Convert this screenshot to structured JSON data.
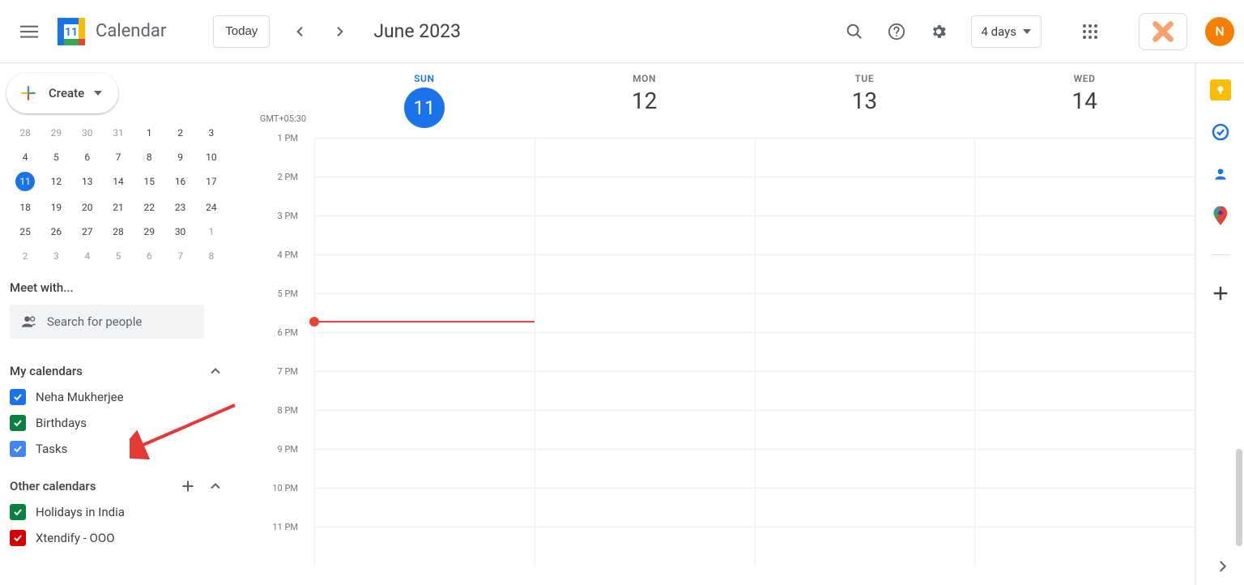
{
  "header": {
    "app_name": "Calendar",
    "today_label": "Today",
    "current_range": "June 2023",
    "view_label": "4 days",
    "avatar_letter": "N"
  },
  "sidebar": {
    "create_label": "Create",
    "mini_calendar": {
      "rows": [
        [
          "28",
          "29",
          "30",
          "31",
          "1",
          "2",
          "3"
        ],
        [
          "4",
          "5",
          "6",
          "7",
          "8",
          "9",
          "10"
        ],
        [
          "11",
          "12",
          "13",
          "14",
          "15",
          "16",
          "17"
        ],
        [
          "18",
          "19",
          "20",
          "21",
          "22",
          "23",
          "24"
        ],
        [
          "25",
          "26",
          "27",
          "28",
          "29",
          "30",
          "1"
        ],
        [
          "2",
          "3",
          "4",
          "5",
          "6",
          "7",
          "8"
        ]
      ],
      "gray_first_row_count": 4,
      "gray_last_rows_after_index": 29,
      "today_value": "11"
    },
    "meet_with_label": "Meet with...",
    "search_placeholder": "Search for people",
    "my_calendars_label": "My calendars",
    "my_calendars": [
      {
        "label": "Neha Mukherjee",
        "color": "#1a73e8"
      },
      {
        "label": "Birthdays",
        "color": "#0b8043"
      },
      {
        "label": "Tasks",
        "color": "#4285f4"
      }
    ],
    "other_calendars_label": "Other calendars",
    "other_calendars": [
      {
        "label": "Holidays in India",
        "color": "#0b8043"
      },
      {
        "label": "Xtendify - OOO",
        "color": "#d50000"
      }
    ]
  },
  "grid": {
    "timezone": "GMT+05:30",
    "days": [
      {
        "dow": "SUN",
        "dom": "11",
        "today": true
      },
      {
        "dow": "MON",
        "dom": "12",
        "today": false
      },
      {
        "dow": "TUE",
        "dom": "13",
        "today": false
      },
      {
        "dow": "WED",
        "dom": "14",
        "today": false
      }
    ],
    "hours": [
      "1 PM",
      "2 PM",
      "3 PM",
      "4 PM",
      "5 PM",
      "6 PM",
      "7 PM",
      "8 PM",
      "9 PM",
      "10 PM",
      "11 PM"
    ]
  }
}
